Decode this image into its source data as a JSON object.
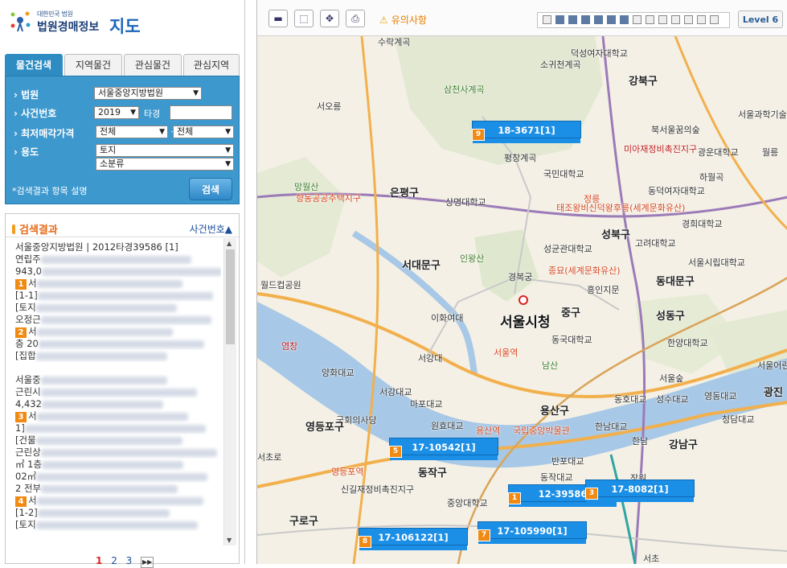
{
  "brand": {
    "small": "대한민국 법원",
    "name": "법원경매정보",
    "section": "지도"
  },
  "tabs": [
    "물건검색",
    "지역물건",
    "관심물건",
    "관심지역"
  ],
  "search": {
    "court_label": "법원",
    "court_value": "서울중앙지방법원",
    "case_label": "사건번호",
    "case_year": "2019",
    "case_type": "타경",
    "price_label": "최저매각가격",
    "price_from": "전체",
    "price_sep": "~",
    "price_to": "전체",
    "use_label": "용도",
    "use_value": "토지",
    "use_sub": "소분류",
    "desc": "*검색결과 항목 설명",
    "button": "검색"
  },
  "results": {
    "title": "검색결과",
    "sort": "사건번호▲",
    "lines": [
      {
        "t": "서울중앙지방법원 | 2012타경39586 [1]"
      },
      {
        "t": "연립주",
        "blur": 1
      },
      {
        "t": "943,0",
        "blur": 1
      },
      {
        "t": "서",
        "num": "1",
        "blur": 1
      },
      {
        "t": "[1-1]",
        "blur": 1
      },
      {
        "t": "[토지",
        "blur": 1
      },
      {
        "t": "오정근",
        "blur": 1
      },
      {
        "t": "서",
        "num": "2",
        "blur": 1
      },
      {
        "t": "층 20",
        "blur": 1
      },
      {
        "t": "[집합",
        "blur": 1
      },
      {
        "t": ""
      },
      {
        "t": "서울중",
        "blur": 1
      },
      {
        "t": "근린시",
        "blur": 1
      },
      {
        "t": "4,432",
        "blur": 1
      },
      {
        "t": "서",
        "num": "3",
        "blur": 1
      },
      {
        "t": "1]",
        "blur": 1
      },
      {
        "t": "[건물",
        "blur": 1
      },
      {
        "t": "근린상",
        "blur": 1
      },
      {
        "t": "㎡ 1층",
        "blur": 1
      },
      {
        "t": "02㎡",
        "blur": 1
      },
      {
        "t": "2 전부",
        "blur": 1
      },
      {
        "t": "서",
        "num": "4",
        "blur": 1
      },
      {
        "t": "[1-2]",
        "blur": 1
      },
      {
        "t": "[토지",
        "blur": 1
      }
    ],
    "pages": [
      "1",
      "2",
      "3"
    ]
  },
  "toolbar": {
    "warning": "유의사항",
    "level": "Level 6"
  },
  "map_labels": {
    "l1": "수락계곡",
    "l2": "덕성여자대학교",
    "l3": "소귀천계곡",
    "l4": "강북구",
    "l5": "삼천사계곡",
    "l6": "서오릉",
    "l7": "서울과학기술",
    "l8": "북서울꿈의숲",
    "l9": "미아재정비촉진지구",
    "l10": "광운대학교",
    "l11": "월릉",
    "l12": "평창계곡",
    "l13": "국민대학교",
    "l14": "하월곡",
    "l15": "은평구",
    "l16": "상명대학교",
    "l17": "동덕여자대학교",
    "l18": "망월산",
    "l19": "향동공공주택지구",
    "l20": "정릉",
    "l21": "태조왕비신덕왕후릉(세계문화유산)",
    "l22": "경희대학교",
    "l23": "성북구",
    "l24": "고려대학교",
    "l25": "서대문구",
    "l26": "인왕산",
    "l27": "성균관대학교",
    "l28": "서울시립대학교",
    "l29": "종묘(세계문화유산)",
    "l30": "동대문구",
    "l31": "월드컵공원",
    "l32": "경복궁",
    "l33": "흥인지문",
    "l34": "서울시청",
    "l35": "중구",
    "l36": "성동구",
    "l37": "이화여대",
    "l38": "한양대학교",
    "l39": "서울역",
    "l40": "동국대학교",
    "l41": "남산",
    "l42": "서강대",
    "l43": "서울숲",
    "l44": "광진",
    "l45": "염창",
    "l46": "양화대교",
    "l47": "서강대교",
    "l48": "마포대교",
    "l49": "용산구",
    "l50": "동호대교",
    "l51": "성수대교",
    "l52": "영동대교",
    "l53": "청담대교",
    "l54": "국회의사당",
    "l55": "원효대교",
    "l56": "용산역",
    "l57": "국립중앙박물관",
    "l58": "한남대교",
    "l59": "한남",
    "l60": "영등포구",
    "l61": "강남구",
    "l62": "반포대교",
    "l63": "영등포역",
    "l64": "동작구",
    "l65": "동작대교",
    "l66": "신길재정비촉진지구",
    "l67": "장원",
    "l68": "중앙대학교",
    "l69": "구로구",
    "l70": "서초",
    "l71": "서울어린이대공원",
    "l72": "서초로"
  },
  "markers": [
    {
      "num": "9",
      "label": "18-3671[1]"
    },
    {
      "num": "5",
      "label": "17-10542[1]"
    },
    {
      "num": "1",
      "label": "12-39586"
    },
    {
      "num": "3",
      "label": "17-8082[1]"
    },
    {
      "num": "8",
      "label": "17-106122[1]"
    },
    {
      "num": "7",
      "label": "17-105990[1]"
    }
  ],
  "colors": {
    "tab_active": "#2e8cc3",
    "search_bg": "#3d98ce",
    "marker": "#1b8ee6",
    "marker_num": "#f18a12",
    "river": "#a7c8e6"
  }
}
